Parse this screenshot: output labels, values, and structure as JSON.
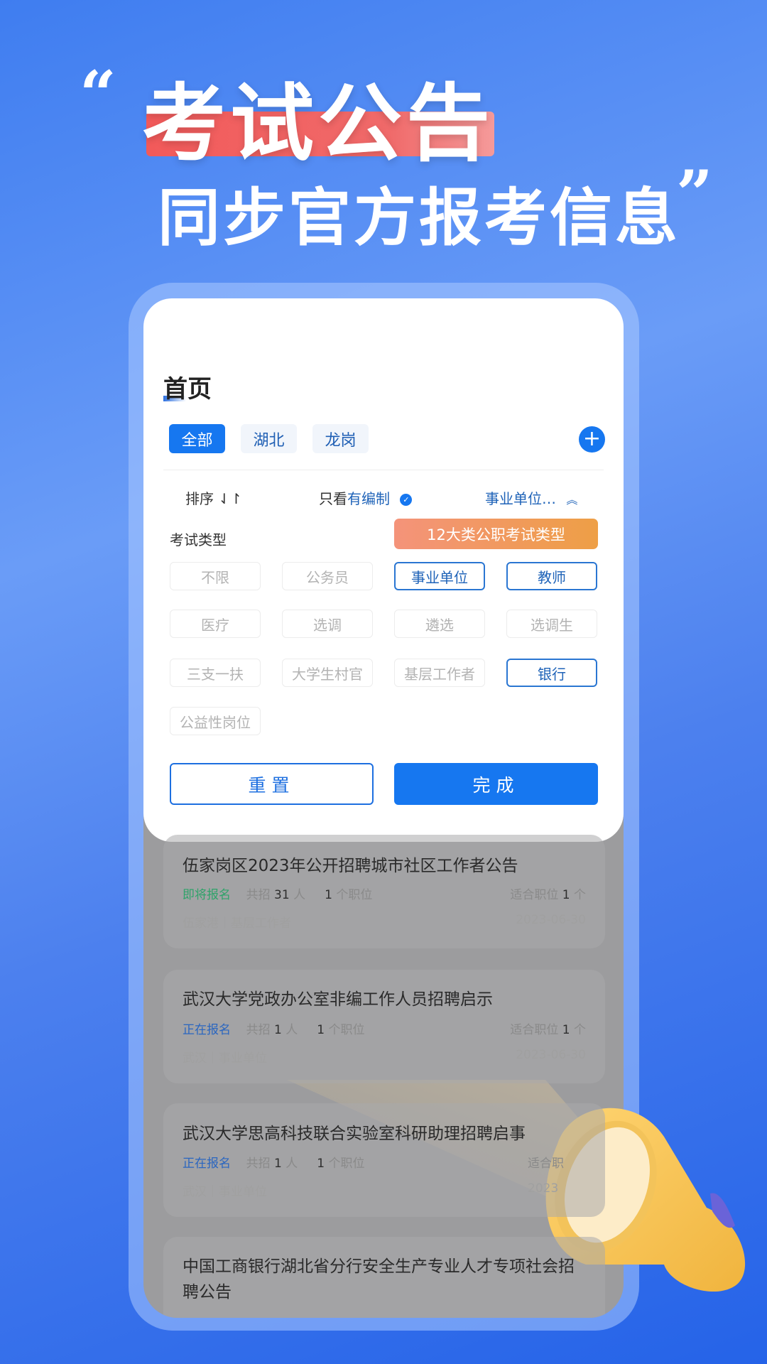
{
  "banner": {
    "open_quote": "“",
    "title": "考试公告",
    "subtitle": "同步官方报考信息",
    "close_quote": "”"
  },
  "header": {
    "title": "首页"
  },
  "tabs": [
    {
      "label": "全部",
      "active": true
    },
    {
      "label": "湖北",
      "active": false
    },
    {
      "label": "龙岗",
      "active": false
    }
  ],
  "add_icon": "plus-circle-icon",
  "filters": {
    "sort": "排序 ⇃↾",
    "only_prefix": "只看",
    "only_value": "有编制",
    "category": "事业单位…"
  },
  "exam_type": {
    "label": "考试类型",
    "badge": "12大类公职考试类型",
    "options": [
      {
        "label": "不限",
        "selected": false
      },
      {
        "label": "公务员",
        "selected": false
      },
      {
        "label": "事业单位",
        "selected": true
      },
      {
        "label": "教师",
        "selected": true
      },
      {
        "label": "医疗",
        "selected": false
      },
      {
        "label": "选调",
        "selected": false
      },
      {
        "label": "遴选",
        "selected": false
      },
      {
        "label": "选调生",
        "selected": false
      },
      {
        "label": "三支一扶",
        "selected": false
      },
      {
        "label": "大学生村官",
        "selected": false
      },
      {
        "label": "基层工作者",
        "selected": false
      },
      {
        "label": "银行",
        "selected": true
      },
      {
        "label": "公益性岗位",
        "selected": false
      }
    ]
  },
  "actions": {
    "reset": "重置",
    "done": "完成"
  },
  "colors": {
    "accent": "#1677f0",
    "badge": "#f09a5a",
    "status_upcoming": "#2fa36a",
    "status_open": "#2a66c0"
  },
  "listings": [
    {
      "title": "伍家岗区2023年公开招聘城市社区工作者公告",
      "status": "即将报名",
      "recruit_prefix": "共招",
      "recruit_count": "31",
      "recruit_unit": "人",
      "positions_count": "1",
      "positions_unit": "个职位",
      "fit_prefix": "适合职位",
      "fit_count": "1",
      "fit_unit": "个",
      "location": "伍家港｜基层工作者",
      "date": "2023-06-30"
    },
    {
      "title": "武汉大学党政办公室非编工作人员招聘启示",
      "status": "正在报名",
      "recruit_prefix": "共招",
      "recruit_count": "1",
      "recruit_unit": "人",
      "positions_count": "1",
      "positions_unit": "个职位",
      "fit_prefix": "适合职位",
      "fit_count": "1",
      "fit_unit": "个",
      "location": "武汉｜事业单位",
      "date": "2023-06-30"
    },
    {
      "title": "武汉大学思高科技联合实验室科研助理招聘启事",
      "status": "正在报名",
      "recruit_prefix": "共招",
      "recruit_count": "1",
      "recruit_unit": "人",
      "positions_count": "1",
      "positions_unit": "个职位",
      "fit_prefix": "适合职",
      "location": "武汉｜事业单位",
      "date": "2023"
    },
    {
      "title": "中国工商银行湖北省分行安全生产专业人才专项社会招聘公告"
    }
  ]
}
